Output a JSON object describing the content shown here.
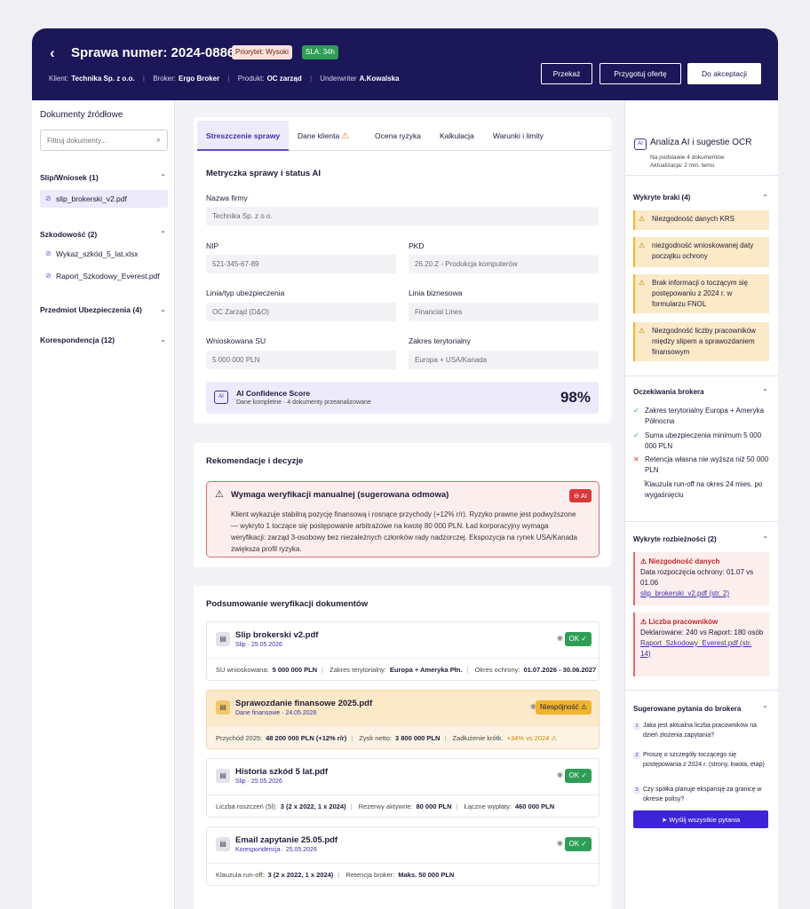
{
  "header": {
    "back_icon": "chevron-left",
    "title": "Sprawa numer: 2024-0886",
    "priority_badge": "Priorytet: Wysoki",
    "sla_badge": "SLA: 34h",
    "meta": [
      {
        "label": "Klient:",
        "value": "Technika Sp. z o.o."
      },
      {
        "label": "Broker:",
        "value": "Ergo Broker"
      },
      {
        "label": "Produkt:",
        "value": "OC zarząd"
      },
      {
        "label": "Underwriter",
        "value": "A.Kowalska"
      }
    ],
    "buttons": {
      "forward": "Przekaż",
      "prepare_offer": "Przygotuj ofertę",
      "accept": "Do akceptacji"
    }
  },
  "left": {
    "title": "Dokumenty źródłowe",
    "filter_placeholder": "Filtruj dokumenty...",
    "groups": [
      {
        "label": "Slip/Wniosek (1)",
        "expanded": true,
        "files": [
          "slip_brokerski_v2.pdf"
        ]
      },
      {
        "label": "Szkodowość (2)",
        "expanded": true,
        "files": [
          "Wykaz_szkód_5_lat.xlsx",
          "Raport_Szkodowy_Everest.pdf"
        ]
      },
      {
        "label": "Przedmiot Ubezpieczenia (4)",
        "expanded": false,
        "files": []
      },
      {
        "label": "Korespondencja (12)",
        "expanded": false,
        "files": []
      }
    ]
  },
  "tabs": [
    "Streszczenie sprawy",
    "Dane klienta",
    "Ocena ryzyka",
    "Kalkulacja",
    "Warunki i limity"
  ],
  "metrics": {
    "title": "Metryczka sprawy i status AI",
    "fields": [
      {
        "label": "Nazwa firmy",
        "value": "Technika Sp. z o.o."
      },
      {
        "label": "NIP",
        "value": "521-345-67-89"
      },
      {
        "label": "PKD",
        "value": "26.20.Z - Produkcja komputerów"
      },
      {
        "label": "Linia/typ ubezpieczenia",
        "value": "OC Zarząd (D&O)"
      },
      {
        "label": "Linia biznesowa",
        "value": "Financial Lines"
      },
      {
        "label": "Wnioskowana SU",
        "value": "5 000 000 PLN"
      },
      {
        "label": "Zakres terytorialny",
        "value": "Europa + USA/Kanada"
      }
    ],
    "ai_score": {
      "chip": "AI",
      "title": "AI Confidence Score",
      "subtitle": "Dane kompletne · 4 dokumenty przeanalizowane",
      "value": "98%"
    }
  },
  "recommendation": {
    "title": "Rekomendacje i decyzje",
    "alert_title": "Wymaga weryfikacji manualnej (sugerowana odmowa)",
    "alert_tag": "AI",
    "alert_text": "Klient wykazuje stabilną pozycję finansową i rosnące przychody (+12% r/r). Ryzyko prawne jest podwyższone — wykryto 1 toczące się postępowanie arbitrażowe na kwotę 80 000 PLN. Ład korporacyjny wymaga weryfikacji: zarząd 3-osobowy bez niezależnych członków rady nadzorczej. Ekspozycja na rynek USA/Kanada zwiększa profil ryzyka."
  },
  "docs": {
    "title": "Podsumowanie weryfikacji dokumentów",
    "items": [
      {
        "name": "Slip brokerski v2.pdf",
        "sub": "Slip · 25.05.2026",
        "status": "OK",
        "fields": [
          {
            "l": "SU wnioskowana:",
            "v": "5 000 000 PLN"
          },
          {
            "l": "Zakres terytorialny:",
            "v": "Europa + Ameryka Płn."
          },
          {
            "l": "Okres ochrony:",
            "v": "01.07.2026 - 30.06.2027"
          }
        ]
      },
      {
        "name": "Sprawozdanie finansowe 2025.pdf",
        "sub": "Dane finansowe · 24.05.2026",
        "status": "Niespójność",
        "fields": [
          {
            "l": "Przychód 2025:",
            "v": "48 200 000 PLN (+12% r/r)"
          },
          {
            "l": "Zysk netto:",
            "v": "3 800 000 PLN"
          },
          {
            "l": "Zadłużenie krótk.",
            "v": "+34% vs 2024"
          }
        ]
      },
      {
        "name": "Historia szkód 5 lat.pdf",
        "sub": "Slip · 25.05.2026",
        "status": "OK",
        "fields": [
          {
            "l": "Liczba roszczeń (5l):",
            "v": "3 (2 x 2022, 1 x 2024)"
          },
          {
            "l": "Rezerwy aktywne:",
            "v": "80 000 PLN"
          },
          {
            "l": "Łączne wypłaty:",
            "v": "460 000 PLN"
          }
        ]
      },
      {
        "name": "Email zapytanie 25.05.pdf",
        "sub": "Korespondencja · 25.05.2026",
        "status": "OK",
        "fields": [
          {
            "l": "Klauzula run-off:",
            "v": "3 (2 x 2022, 1 x 2024)"
          },
          {
            "l": "Retencja broker:",
            "v": "Maks. 50 000 PLN"
          }
        ]
      }
    ]
  },
  "right": {
    "title": "Analiza AI i sugestie OCR",
    "chip": "AI",
    "sub1": "Na podstawie 4 dokumentów",
    "sub2": "Aktualizacja: 2 min. temu",
    "gaps_title": "Wykryte braki (4)",
    "gaps": [
      "Niezgodność danych KRS",
      "niezgodność wnioskowanej daty początku ochrony",
      "Brak informacji o toczącym się postępowaniu z 2024 r. w formularzu FNOL",
      "Niezgodność liczby pracowników między slipem a sprawozdaniem finansowym"
    ],
    "exp_title": "Oczekiwania brokera",
    "expectations": [
      {
        "mark": "✓",
        "kind": "ok",
        "text": "Zakres terytorialny Europa + Ameryka Północna"
      },
      {
        "mark": "✓",
        "kind": "ok",
        "text": "Suma ubezpieczenia minimum 5 000 000 PLN"
      },
      {
        "mark": "✕",
        "kind": "no",
        "text": "Retencja własna nie wyższa niż 50 000 PLN"
      },
      {
        "mark": "?",
        "kind": "q",
        "text": "Klauzula run-off na okres 24 mies. po wygaśnięciu"
      }
    ],
    "disc_title": "Wykryte rozbieżności (2)",
    "discrepancies": [
      {
        "title": "Niezgodność danych",
        "text": "Data rozpoczęcia ochrony: 01.07 vs 01.06",
        "link": "slip_brokerski_v2.pdf (str. 2)"
      },
      {
        "title": "Liczba pracowników",
        "text": "Deklarowane: 240 vs Raport: 180 osób",
        "link": "Raport_Szkodowy_Everest.pdf (str. 14)"
      }
    ],
    "questions_title": "Sugerowane pytania do brokera",
    "questions": [
      "Jaka jest aktualna liczba pracowników na dzień złożenia zapytania?",
      "Proszę o szczegóły toczącego się postępowania z 2024 r. (strony, kwota, etap)",
      "Czy spółka planuje ekspansję za granicę w okresie polisy?"
    ],
    "send_button": "Wyślij wszystkie pytania"
  }
}
